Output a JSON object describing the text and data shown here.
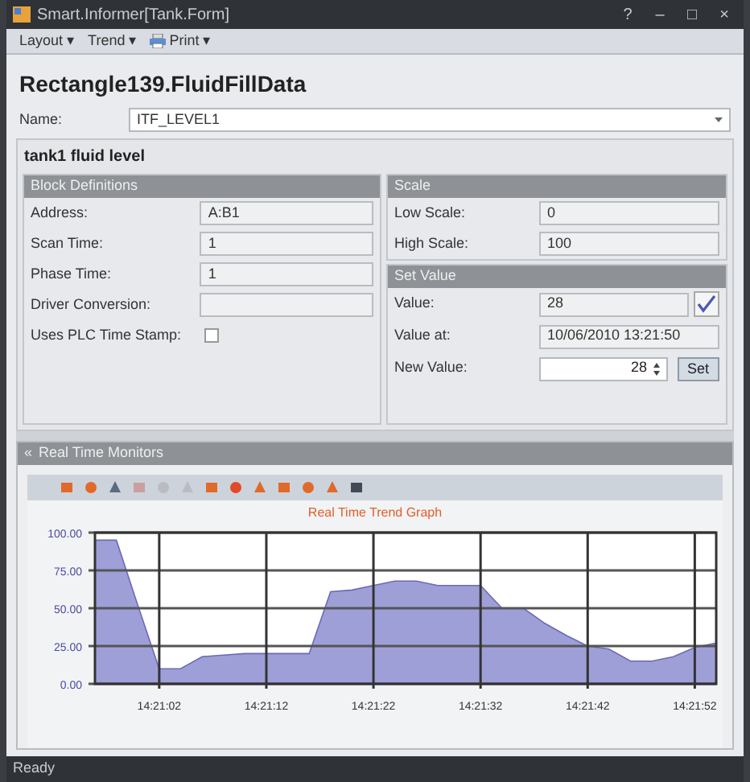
{
  "window": {
    "title": "Smart.Informer[Tank.Form]",
    "controls": [
      "?",
      "–",
      "□",
      "×"
    ]
  },
  "menu": [
    {
      "label": "Layout",
      "kind": "plain",
      "arrow": "▾"
    },
    {
      "label": "Trend",
      "kind": "plain",
      "arrow": "▾"
    },
    {
      "label": "Print",
      "kind": "icon",
      "arrow": "▾"
    }
  ],
  "heading": "Rectangle139.FluidFillData",
  "name_field": {
    "label": "Name:",
    "value": "ITF_LEVEL1"
  },
  "group_title": "tank1 fluid level",
  "block_definitions": {
    "title": "Block Definitions",
    "rows": [
      {
        "kind": "text",
        "label": "Address:",
        "value": "A:B1"
      },
      {
        "kind": "text",
        "label": "Scan Time:",
        "value": "1"
      },
      {
        "kind": "text",
        "label": "Phase Time:",
        "value": "1"
      },
      {
        "kind": "text",
        "label": "Driver Conversion:"
      },
      {
        "kind": "checkbox",
        "label": "Uses PLC Time Stamp:",
        "checked": false
      }
    ]
  },
  "scale": {
    "title": "Scale",
    "rows": [
      {
        "label": "Low Scale:",
        "value": "0"
      },
      {
        "label": "High Scale:",
        "value": "100"
      }
    ]
  },
  "set_value": {
    "title": "Set Value",
    "rows": [
      {
        "kind": "confirmed",
        "label": "Value:",
        "value": "28"
      },
      {
        "kind": "text",
        "label": "Value at:",
        "value": "10/06/2010 13:21:50"
      },
      {
        "kind": "spin",
        "label": "New Value:",
        "value": "28",
        "button": "Set"
      }
    ]
  },
  "monitor": {
    "title": "Real Time Monitors",
    "collapse": "«",
    "chart_data": {
      "type": "area",
      "title": "Real Time Trend Graph",
      "categories": [
        null,
        null,
        null,
        "14:21:02",
        null,
        null,
        null,
        null,
        "14:21:12",
        null,
        null,
        null,
        null,
        "14:21:22",
        null,
        null,
        null,
        null,
        "14:21:32",
        null,
        null,
        null,
        null,
        "14:21:42",
        null,
        null,
        null,
        null,
        "14:21:52",
        null
      ],
      "series": [
        {
          "color": "#9f9fd8",
          "values": [
            95,
            95,
            52,
            10,
            10,
            18,
            19,
            20,
            20,
            20,
            20,
            61,
            62,
            65,
            68,
            68,
            65,
            65,
            65,
            50,
            50,
            40,
            32,
            25,
            23,
            15,
            15,
            18,
            24,
            27
          ]
        }
      ],
      "ylim": [
        0,
        100
      ],
      "grid": true,
      "yticks": [
        {
          "value": 0,
          "label": "0.00"
        },
        {
          "value": 25,
          "label": "25.00"
        },
        {
          "value": 50,
          "label": "50.00"
        },
        {
          "value": 75,
          "label": "75.00"
        },
        {
          "value": 100,
          "label": "100.00"
        }
      ]
    }
  },
  "status_bar": "Ready"
}
